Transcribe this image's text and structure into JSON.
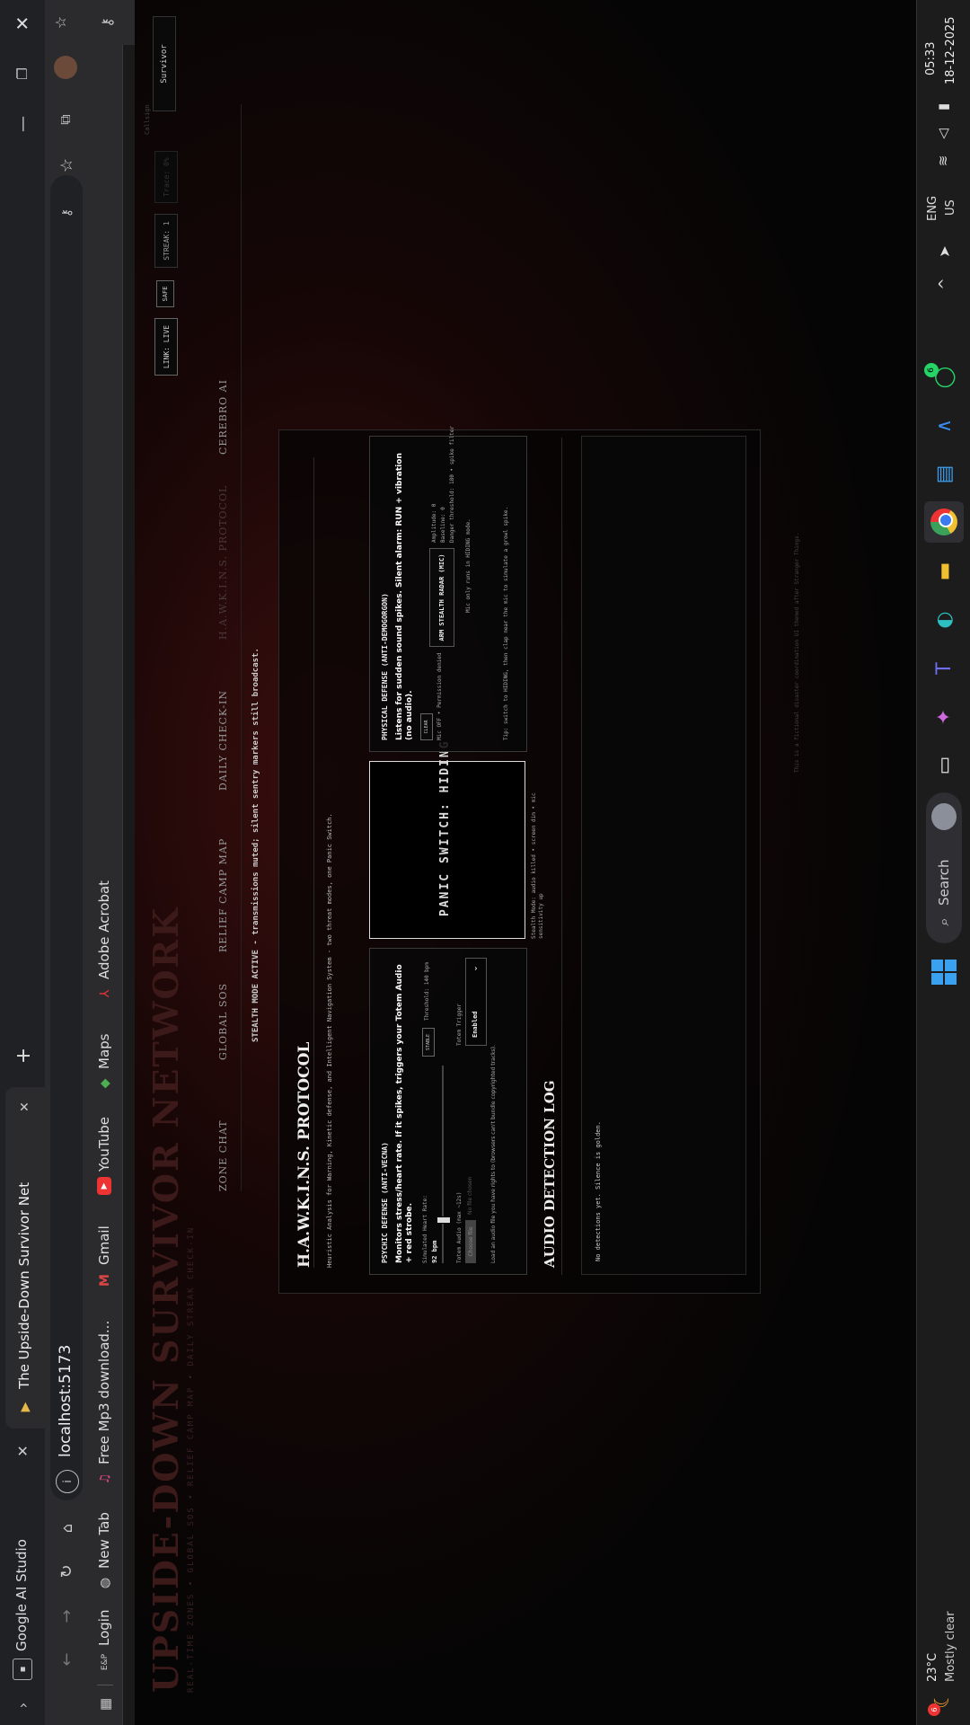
{
  "browser": {
    "tab_title": "The Upside-Down Survivor Net",
    "tab_studio_label": "Google AI Studio",
    "url": "localhost:5173",
    "bookmarks": [
      "Login",
      "New Tab",
      "Free Mp3 download...",
      "Gmail",
      "YouTube",
      "Maps",
      "Adobe Acrobat"
    ]
  },
  "app": {
    "brand_title": "UPSIDE-DOWN SURVIVOR NETWORK",
    "brand_subtitle": "REAL-TIME ZONES • GLOBAL SOS • RELIEF CAMP MAP • DAILY STREAK CHECK-IN",
    "status": {
      "link": "LINK: LIVE",
      "safe": "SAFE",
      "streak": "STREAK: 1",
      "faded": "Trace: 0%",
      "callsign_label": "Callsign",
      "callsign_value": "Survivor"
    },
    "nav": [
      "ZONE CHAT",
      "GLOBAL SOS",
      "RELIEF CAMP MAP",
      "DAILY CHECK-IN",
      "H.A.W.K.I.N.S. PROTOCOL",
      "CEREBRO AI"
    ],
    "stealth_banner": "STEALTH MODE ACTIVE - transmissions muted; silent sentry markers still broadcast.",
    "footer": "This is a fictional disaster coordination UI themed after Stranger Things."
  },
  "hawkins": {
    "title": "H.A.W.K.I.N.S. PROTOCOL",
    "subtitle": "Heuristic Analysis for Warning, Kinetic defense, and Intelligent Navigation System - two threat modes, one Panic Switch.",
    "psychic": {
      "title": "PSYCHIC DEFENSE (ANTI-VECNA)",
      "desc": "Monitors stress/heart rate. If it spikes, triggers your Totem Audio + red strobe.",
      "hr_label": "Simulated Heart Rate:",
      "hr_value": "92 bpm",
      "badge": "STABLE",
      "threshold": "Threshold: 140 bpm",
      "totem_audio_label": "Totem Audio (max ~12s)",
      "file_button": "Choose file",
      "file_status": "No file chosen",
      "trigger_label": "Totem Trigger",
      "trigger_value": "Enabled",
      "note": "Load an audio file you have rights to (browsers can't bundle copyrighted tracks)."
    },
    "panic": {
      "label": "PANIC SWITCH: HIDING",
      "note": "Stealth Mode: audio killed • screen dim • mic sensitivity up"
    },
    "physical": {
      "title": "PHYSICAL DEFENSE (ANTI-DEMOGORGON)",
      "desc": "Listens for sudden sound spikes. Silent alarm: RUN + vibration (no audio).",
      "badge": "CLEAR",
      "mic_status": "Mic OFF • Permission denied",
      "arm_button": "ARM STEALTH RADAR (MIC)",
      "stats": [
        "Amplitude: 0",
        "Baseline: 0",
        "Danger threshold: 180 • spike filter"
      ],
      "mic_note": "Mic only runs in HIDING mode.",
      "tip": "Tip: switch to HIDING, then clap near the mic to simulate a growl spike."
    },
    "log": {
      "title": "AUDIO DETECTION LOG",
      "empty": "No detections yet. Silence is golden."
    }
  },
  "taskbar": {
    "weather_temp": "23°C",
    "weather_desc": "Mostly clear",
    "weather_badge": "6",
    "search": "Search",
    "whatsapp_badge": "6",
    "lang": "ENG",
    "region": "US",
    "time": "05:33",
    "date": "18-12-2025"
  }
}
